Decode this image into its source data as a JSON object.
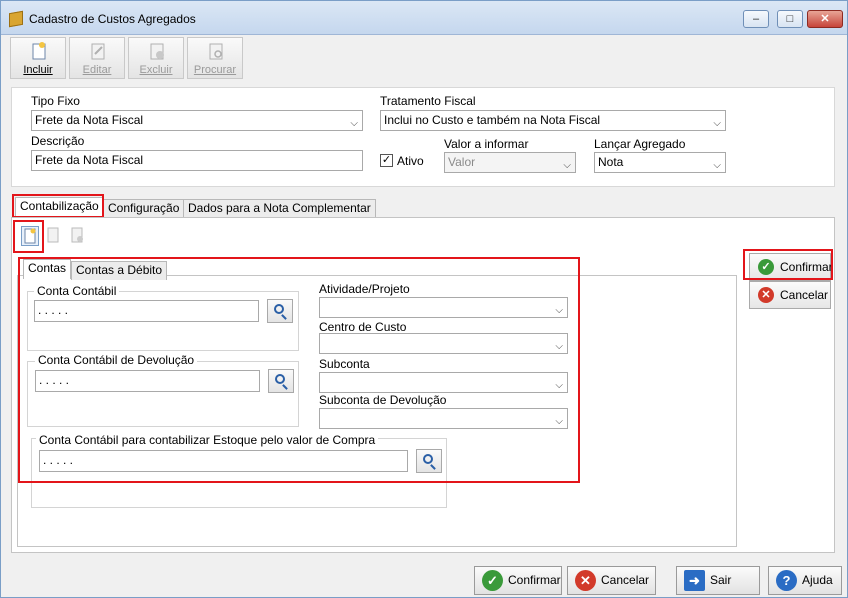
{
  "window": {
    "title": "Cadastro de Custos Agregados"
  },
  "window_controls": {
    "minimize": "–",
    "maximize": "□",
    "close": "✕"
  },
  "toolbar": {
    "incluir": "Incluir",
    "editar": "Editar",
    "excluir": "Excluir",
    "procurar": "Procurar"
  },
  "form": {
    "tipo_fixo_label": "Tipo Fixo",
    "tipo_fixo_value": "Frete da Nota Fiscal",
    "tratamento_label": "Tratamento Fiscal",
    "tratamento_value": "Inclui no Custo e também na Nota Fiscal",
    "descricao_label": "Descrição",
    "descricao_value": "Frete da Nota Fiscal",
    "ativo_label": "Ativo",
    "ativo_checked": "✓",
    "valor_label": "Valor a informar",
    "valor_value": "Valor",
    "lancar_label": "Lançar Agregado",
    "lancar_value": "Nota"
  },
  "tabs": {
    "contabilizacao": "Contabilização",
    "configuracao": "Configuração",
    "dados_nota": "Dados para a Nota Complementar"
  },
  "subtabs": {
    "contas": "Contas",
    "contas_debito": "Contas a Débito"
  },
  "contas": {
    "conta_contabil_label": "Conta Contábil",
    "conta_contabil_value": ". . . . .",
    "conta_devolucao_label": "Conta Contábil de Devolução",
    "conta_devolucao_value": ". . . . .",
    "conta_estoque_label": "Conta Contábil para contabilizar Estoque pelo valor de Compra",
    "conta_estoque_value": ". . . . .",
    "atividade_label": "Atividade/Projeto",
    "centro_label": "Centro de Custo",
    "subconta_label": "Subconta",
    "subconta_dev_label": "Subconta de Devolução"
  },
  "side_buttons": {
    "confirmar": "Confirmar",
    "cancelar": "Cancelar"
  },
  "bottom_buttons": {
    "confirmar": "Confirmar",
    "cancelar": "Cancelar",
    "sair": "Sair",
    "ajuda": "Ajuda"
  },
  "colors": {
    "highlight": "#e3151a",
    "confirm_green": "#3a9a3a",
    "cancel_red": "#d23a2a",
    "help_blue": "#2a6cc4"
  }
}
